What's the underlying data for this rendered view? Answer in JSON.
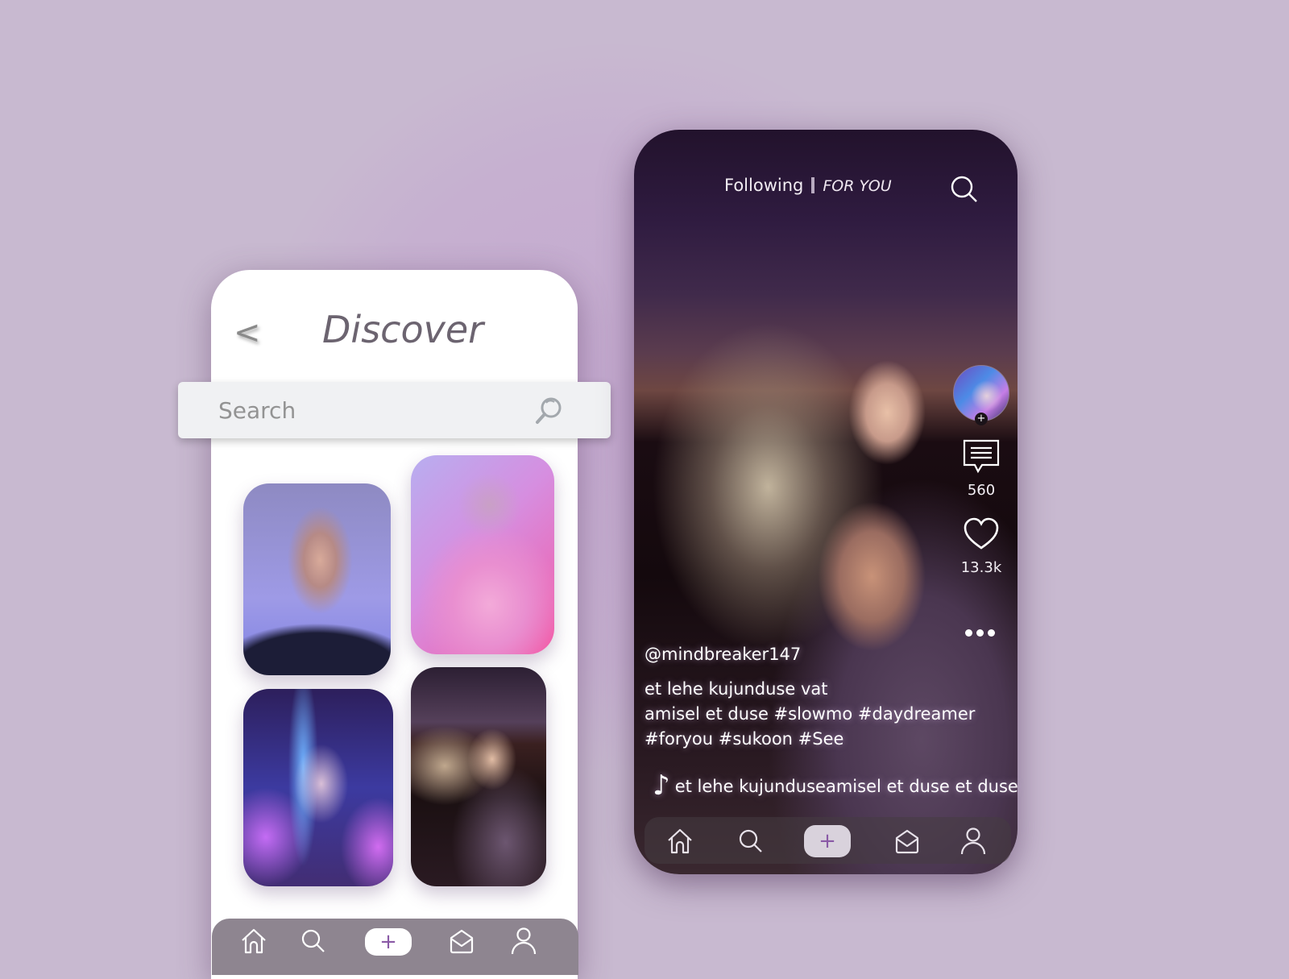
{
  "discover_screen": {
    "back_label": "<",
    "title": "Discover",
    "search": {
      "placeholder": "Search",
      "value": ""
    },
    "tiles": [
      {
        "name": "portrait-blue-woman"
      },
      {
        "name": "portrait-pink-jacket"
      },
      {
        "name": "portrait-neon-lights"
      },
      {
        "name": "portrait-windswept-blonde"
      }
    ],
    "bottom_nav": {
      "items": [
        {
          "icon": "home-icon",
          "label": "Home"
        },
        {
          "icon": "search-icon",
          "label": "Search"
        },
        {
          "icon": "plus-icon",
          "label": "+"
        },
        {
          "icon": "inbox-icon",
          "label": "Inbox"
        },
        {
          "icon": "profile-icon",
          "label": "Profile"
        }
      ]
    }
  },
  "feed_screen": {
    "tabs": {
      "following": "Following",
      "for_you": "FOR YOU"
    },
    "actions": {
      "avatar_plus": "+",
      "comments_count": "560",
      "likes_count": "13.3k"
    },
    "post": {
      "username": "@mindbreaker147",
      "description_lines": [
        "et lehe kujunduse vat",
        "amisel et duse #slowmo #daydreamer",
        "#foryou #sukoon #See"
      ],
      "music_note": "♪",
      "song": "et lehe kujunduseamisel et duse et duse"
    },
    "bottom_nav": {
      "items": [
        {
          "icon": "home-icon",
          "label": "Home"
        },
        {
          "icon": "search-icon",
          "label": "Search"
        },
        {
          "icon": "plus-icon",
          "label": "+"
        },
        {
          "icon": "inbox-icon",
          "label": "Inbox"
        },
        {
          "icon": "profile-icon",
          "label": "Profile"
        }
      ]
    }
  },
  "colors": {
    "background": "#c8b9d0",
    "accent_purple": "#8a5aa6",
    "nav_bar_gray": "#8e8590",
    "title_gray": "#6c6470"
  }
}
